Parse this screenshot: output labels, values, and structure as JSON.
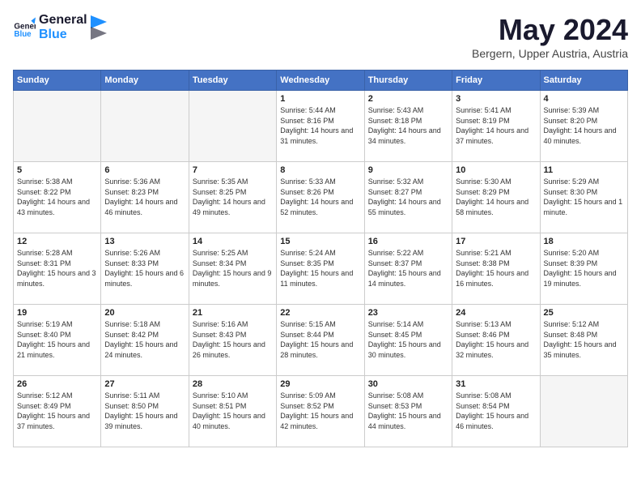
{
  "header": {
    "logo_line1": "General",
    "logo_line2": "Blue",
    "month": "May 2024",
    "location": "Bergern, Upper Austria, Austria"
  },
  "weekdays": [
    "Sunday",
    "Monday",
    "Tuesday",
    "Wednesday",
    "Thursday",
    "Friday",
    "Saturday"
  ],
  "weeks": [
    [
      {
        "day": "",
        "info": ""
      },
      {
        "day": "",
        "info": ""
      },
      {
        "day": "",
        "info": ""
      },
      {
        "day": "1",
        "info": "Sunrise: 5:44 AM\nSunset: 8:16 PM\nDaylight: 14 hours\nand 31 minutes."
      },
      {
        "day": "2",
        "info": "Sunrise: 5:43 AM\nSunset: 8:18 PM\nDaylight: 14 hours\nand 34 minutes."
      },
      {
        "day": "3",
        "info": "Sunrise: 5:41 AM\nSunset: 8:19 PM\nDaylight: 14 hours\nand 37 minutes."
      },
      {
        "day": "4",
        "info": "Sunrise: 5:39 AM\nSunset: 8:20 PM\nDaylight: 14 hours\nand 40 minutes."
      }
    ],
    [
      {
        "day": "5",
        "info": "Sunrise: 5:38 AM\nSunset: 8:22 PM\nDaylight: 14 hours\nand 43 minutes."
      },
      {
        "day": "6",
        "info": "Sunrise: 5:36 AM\nSunset: 8:23 PM\nDaylight: 14 hours\nand 46 minutes."
      },
      {
        "day": "7",
        "info": "Sunrise: 5:35 AM\nSunset: 8:25 PM\nDaylight: 14 hours\nand 49 minutes."
      },
      {
        "day": "8",
        "info": "Sunrise: 5:33 AM\nSunset: 8:26 PM\nDaylight: 14 hours\nand 52 minutes."
      },
      {
        "day": "9",
        "info": "Sunrise: 5:32 AM\nSunset: 8:27 PM\nDaylight: 14 hours\nand 55 minutes."
      },
      {
        "day": "10",
        "info": "Sunrise: 5:30 AM\nSunset: 8:29 PM\nDaylight: 14 hours\nand 58 minutes."
      },
      {
        "day": "11",
        "info": "Sunrise: 5:29 AM\nSunset: 8:30 PM\nDaylight: 15 hours\nand 1 minute."
      }
    ],
    [
      {
        "day": "12",
        "info": "Sunrise: 5:28 AM\nSunset: 8:31 PM\nDaylight: 15 hours\nand 3 minutes."
      },
      {
        "day": "13",
        "info": "Sunrise: 5:26 AM\nSunset: 8:33 PM\nDaylight: 15 hours\nand 6 minutes."
      },
      {
        "day": "14",
        "info": "Sunrise: 5:25 AM\nSunset: 8:34 PM\nDaylight: 15 hours\nand 9 minutes."
      },
      {
        "day": "15",
        "info": "Sunrise: 5:24 AM\nSunset: 8:35 PM\nDaylight: 15 hours\nand 11 minutes."
      },
      {
        "day": "16",
        "info": "Sunrise: 5:22 AM\nSunset: 8:37 PM\nDaylight: 15 hours\nand 14 minutes."
      },
      {
        "day": "17",
        "info": "Sunrise: 5:21 AM\nSunset: 8:38 PM\nDaylight: 15 hours\nand 16 minutes."
      },
      {
        "day": "18",
        "info": "Sunrise: 5:20 AM\nSunset: 8:39 PM\nDaylight: 15 hours\nand 19 minutes."
      }
    ],
    [
      {
        "day": "19",
        "info": "Sunrise: 5:19 AM\nSunset: 8:40 PM\nDaylight: 15 hours\nand 21 minutes."
      },
      {
        "day": "20",
        "info": "Sunrise: 5:18 AM\nSunset: 8:42 PM\nDaylight: 15 hours\nand 24 minutes."
      },
      {
        "day": "21",
        "info": "Sunrise: 5:16 AM\nSunset: 8:43 PM\nDaylight: 15 hours\nand 26 minutes."
      },
      {
        "day": "22",
        "info": "Sunrise: 5:15 AM\nSunset: 8:44 PM\nDaylight: 15 hours\nand 28 minutes."
      },
      {
        "day": "23",
        "info": "Sunrise: 5:14 AM\nSunset: 8:45 PM\nDaylight: 15 hours\nand 30 minutes."
      },
      {
        "day": "24",
        "info": "Sunrise: 5:13 AM\nSunset: 8:46 PM\nDaylight: 15 hours\nand 32 minutes."
      },
      {
        "day": "25",
        "info": "Sunrise: 5:12 AM\nSunset: 8:48 PM\nDaylight: 15 hours\nand 35 minutes."
      }
    ],
    [
      {
        "day": "26",
        "info": "Sunrise: 5:12 AM\nSunset: 8:49 PM\nDaylight: 15 hours\nand 37 minutes."
      },
      {
        "day": "27",
        "info": "Sunrise: 5:11 AM\nSunset: 8:50 PM\nDaylight: 15 hours\nand 39 minutes."
      },
      {
        "day": "28",
        "info": "Sunrise: 5:10 AM\nSunset: 8:51 PM\nDaylight: 15 hours\nand 40 minutes."
      },
      {
        "day": "29",
        "info": "Sunrise: 5:09 AM\nSunset: 8:52 PM\nDaylight: 15 hours\nand 42 minutes."
      },
      {
        "day": "30",
        "info": "Sunrise: 5:08 AM\nSunset: 8:53 PM\nDaylight: 15 hours\nand 44 minutes."
      },
      {
        "day": "31",
        "info": "Sunrise: 5:08 AM\nSunset: 8:54 PM\nDaylight: 15 hours\nand 46 minutes."
      },
      {
        "day": "",
        "info": ""
      }
    ]
  ]
}
